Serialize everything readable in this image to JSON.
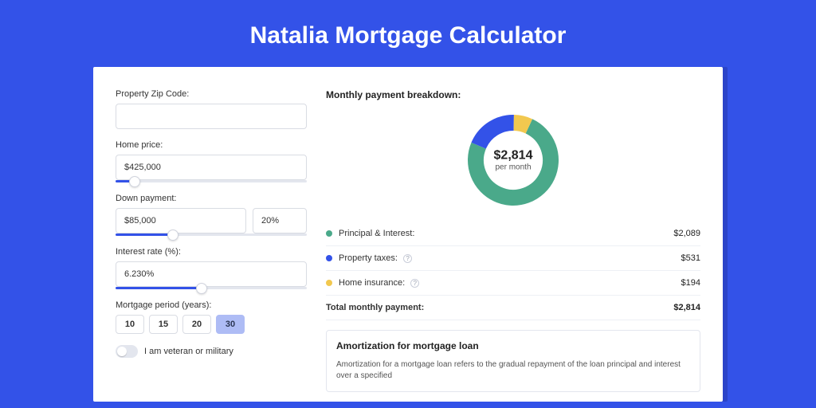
{
  "title": "Natalia Mortgage Calculator",
  "form": {
    "zip": {
      "label": "Property Zip Code:",
      "value": ""
    },
    "home_price": {
      "label": "Home price:",
      "value": "$425,000",
      "slider_pct": 10
    },
    "down_payment": {
      "label": "Down payment:",
      "amount": "$85,000",
      "percent": "20%",
      "slider_pct": 30
    },
    "interest_rate": {
      "label": "Interest rate (%):",
      "value": "6.230%",
      "slider_pct": 45
    },
    "period": {
      "label": "Mortgage period (years):",
      "options": [
        "10",
        "15",
        "20",
        "30"
      ],
      "active": "30"
    },
    "veteran": {
      "label": "I am veteran or military",
      "on": false
    }
  },
  "breakdown": {
    "heading": "Monthly payment breakdown:",
    "center_amount": "$2,814",
    "center_unit": "per month",
    "items": [
      {
        "label": "Principal & Interest:",
        "value": "$2,089",
        "color": "#4aa98a",
        "help": false
      },
      {
        "label": "Property taxes:",
        "value": "$531",
        "color": "#3352e8",
        "help": true
      },
      {
        "label": "Home insurance:",
        "value": "$194",
        "color": "#f2c84f",
        "help": true
      }
    ],
    "total_label": "Total monthly payment:",
    "total_value": "$2,814"
  },
  "amortization": {
    "title": "Amortization for mortgage loan",
    "text": "Amortization for a mortgage loan refers to the gradual repayment of the loan principal and interest over a specified"
  },
  "chart_data": {
    "type": "pie",
    "title": "Monthly payment breakdown",
    "series": [
      {
        "name": "Principal & Interest",
        "value": 2089,
        "color": "#4aa98a"
      },
      {
        "name": "Property taxes",
        "value": 531,
        "color": "#3352e8"
      },
      {
        "name": "Home insurance",
        "value": 194,
        "color": "#f2c84f"
      }
    ],
    "total": 2814
  }
}
